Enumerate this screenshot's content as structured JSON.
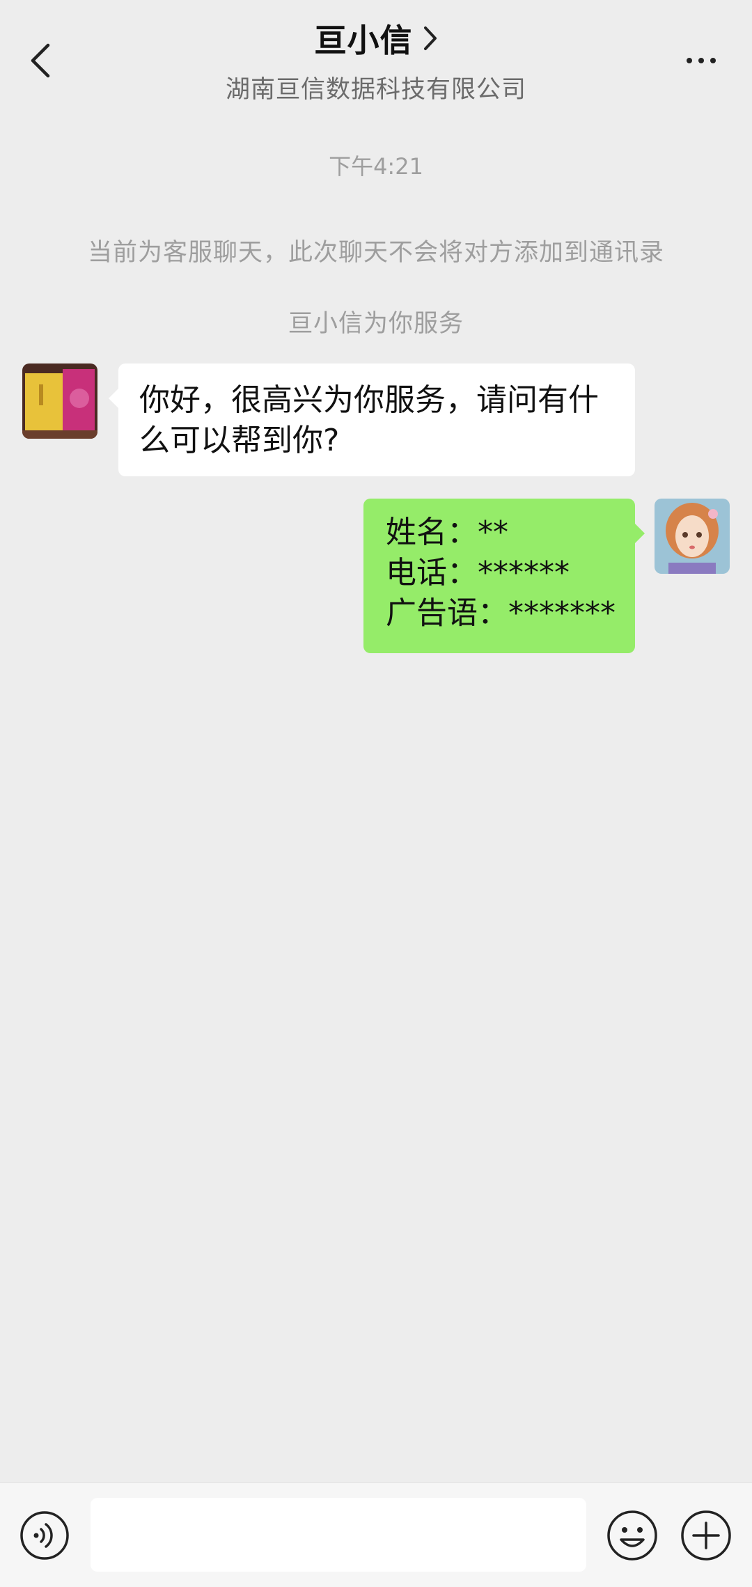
{
  "header": {
    "title": "亘小信",
    "subtitle": "湖南亘信数据科技有限公司"
  },
  "chat": {
    "timestamp": "下午4:21",
    "system_notice": "当前为客服聊天，此次聊天不会将对方添加到通讯录",
    "service_notice": "亘小信为你服务",
    "messages": [
      {
        "from": "agent",
        "lines": [
          "你好，很高兴为你服务，请问有什",
          "么可以帮到你?"
        ]
      },
      {
        "from": "me",
        "lines": [
          "姓名：**",
          "电话：******",
          "广告语：*******"
        ]
      }
    ]
  },
  "input": {
    "placeholder": "",
    "value": ""
  },
  "icons": {
    "back": "chevron-left-icon",
    "title_arrow": "chevron-right-icon",
    "more": "more-dots-icon",
    "voice": "voice-icon",
    "emoji": "emoji-icon",
    "plus": "plus-icon"
  },
  "colors": {
    "background": "#ededed",
    "bubble_incoming": "#ffffff",
    "bubble_outgoing": "#95ec69",
    "system_text": "#9e9e9e"
  }
}
